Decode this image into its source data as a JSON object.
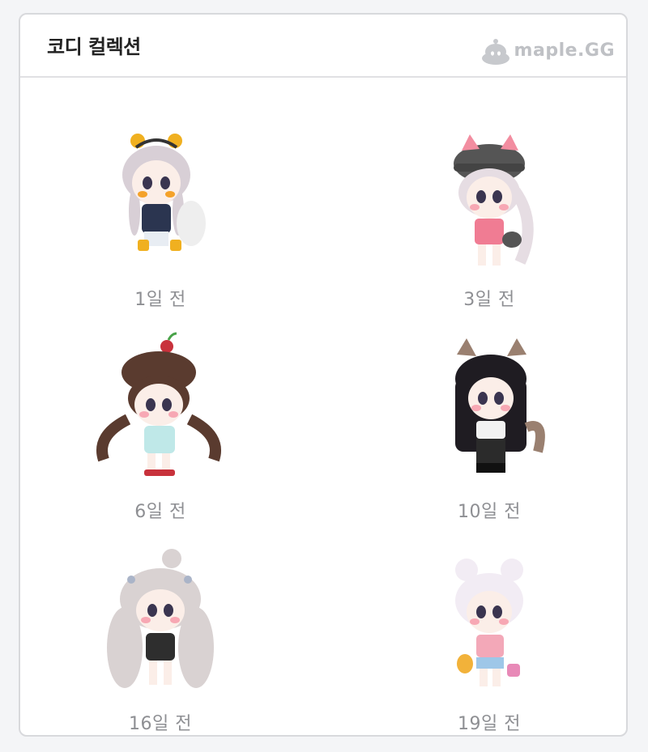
{
  "card": {
    "title": "코디 컬렉션"
  },
  "brand": {
    "name": "maple.GG"
  },
  "items": [
    {
      "days_ago": "1일 전",
      "hair": "#d8cfd6",
      "outfit": "#2b3550",
      "accent": "#f0b020"
    },
    {
      "days_ago": "3일 전",
      "hair": "#e6dde3",
      "outfit": "#f07c93",
      "accent": "#555555"
    },
    {
      "days_ago": "6일 전",
      "hair": "#5a3b2f",
      "outfit": "#bfe8e8",
      "accent": "#c8323c"
    },
    {
      "days_ago": "10일 전",
      "hair": "#1f1c22",
      "outfit": "#f2f2f2",
      "accent": "#2b2b2b"
    },
    {
      "days_ago": "16일 전",
      "hair": "#d9d2d2",
      "outfit": "#2e2e2e",
      "accent": "#aab4c8"
    },
    {
      "days_ago": "19일 전",
      "hair": "#f2ecf4",
      "outfit": "#f3a8b8",
      "accent": "#f2b23a"
    }
  ]
}
